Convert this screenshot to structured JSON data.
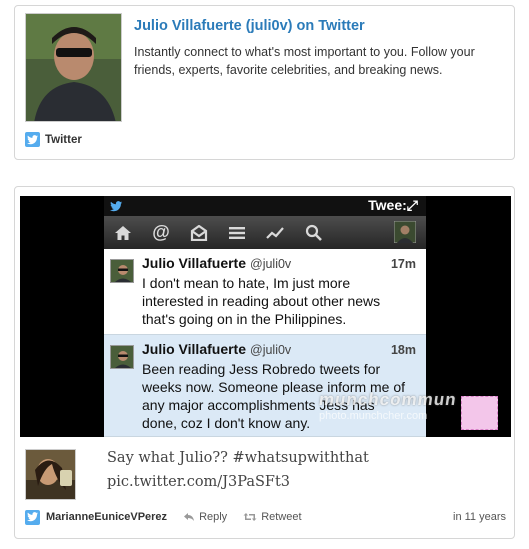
{
  "profile_card": {
    "title": "Julio Villafuerte (juli0v) on Twitter",
    "description": "Instantly connect to what's most important to you. Follow your friends, experts, favorite celebrities, and breaking news.",
    "source_label": "Twitter"
  },
  "post_card": {
    "screenshot": {
      "status_title": "Twee:⤢",
      "toolbar_icons": [
        "home-icon",
        "mentions-icon",
        "messages-icon",
        "menu-icon",
        "trends-icon",
        "search-icon",
        "profile-icon"
      ],
      "tweets": [
        {
          "name": "Julio Villafuerte",
          "handle": "@juli0v",
          "time": "17m",
          "text": "I don't mean to hate, Im just more interested in reading about other news that's going on in the Philippines."
        },
        {
          "name": "Julio Villafuerte",
          "handle": "@juli0v",
          "time": "18m",
          "text": "Been reading Jess Robredo tweets for weeks now. Someone please inform me of any major accomplishments Jess has done, coz I don't know any."
        }
      ],
      "watermark": "munchcommun",
      "watermark_sub": "photo.munchcher.com"
    },
    "post_text": "Say what Julio?? #whatsupwiththat",
    "post_link": "pic.twitter.com/J3PaSFt3",
    "footer": {
      "username": "MarianneEuniceVPerez",
      "reply_label": "Reply",
      "retweet_label": "Retweet",
      "time": "in 11 years"
    }
  },
  "colors": {
    "twitter_blue": "#55acee",
    "link_blue": "#2b7bb9",
    "highlight_tweet_bg": "#dbe9f6"
  }
}
